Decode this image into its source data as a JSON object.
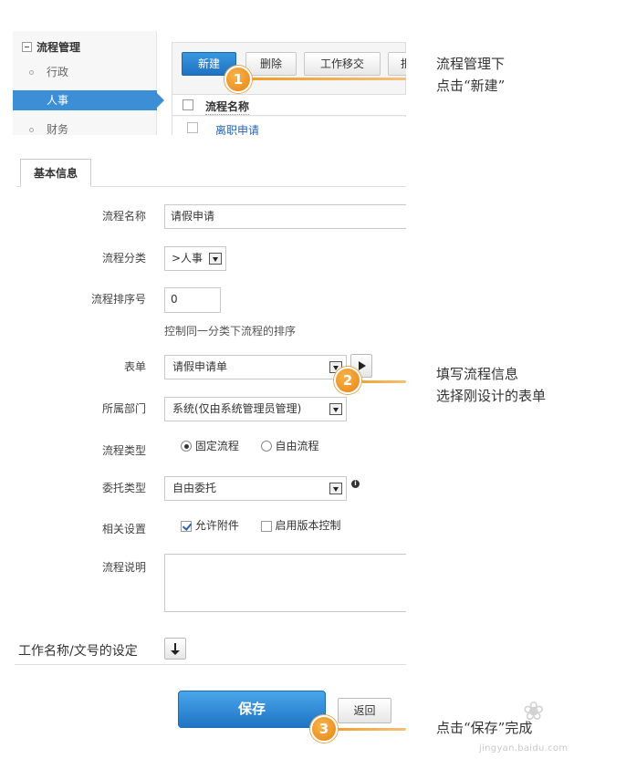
{
  "sidebar": {
    "title": "流程管理",
    "items": [
      {
        "label": "行政",
        "active": false
      },
      {
        "label": "人事",
        "active": true
      },
      {
        "label": "财务",
        "active": false
      }
    ]
  },
  "toolbar": {
    "new_label": "新建",
    "delete_label": "删除",
    "transfer_label": "工作移交",
    "batch_label": "批"
  },
  "list": {
    "column_header": "流程名称",
    "rows": [
      "离职申请"
    ]
  },
  "tabs": [
    {
      "label": "基本信息",
      "active": true
    }
  ],
  "form": {
    "name": {
      "label": "流程名称",
      "value": "请假申请"
    },
    "category": {
      "label": "流程分类",
      "value": ">人事"
    },
    "order": {
      "label": "流程排序号",
      "value": "0",
      "hint": "控制同一分类下流程的排序"
    },
    "form_select": {
      "label": "表单",
      "value": "请假申请单"
    },
    "department": {
      "label": "所属部门",
      "value": "系统(仅由系统管理员管理)"
    },
    "flow_type": {
      "label": "流程类型",
      "options": [
        "固定流程",
        "自由流程"
      ],
      "selected": "固定流程"
    },
    "delegate_type": {
      "label": "委托类型",
      "value": "自由委托"
    },
    "settings": {
      "label": "相关设置",
      "options": [
        {
          "label": "允许附件",
          "checked": true
        },
        {
          "label": "启用版本控制",
          "checked": false
        }
      ]
    },
    "description": {
      "label": "流程说明",
      "value": ""
    }
  },
  "section": {
    "title": "工作名称/文号的设定"
  },
  "actions": {
    "save_label": "保存",
    "back_label": "返回"
  },
  "annotations": {
    "step1": {
      "number": "1",
      "line1": "流程管理下",
      "line2": "点击“新建”"
    },
    "step2": {
      "number": "2",
      "line1": "填写流程信息",
      "line2": "选择刚设计的表单"
    },
    "step3": {
      "number": "3",
      "line1": "点击“保存”完成"
    }
  },
  "watermark": {
    "text": "jingyan.baidu.com"
  },
  "colors": {
    "primary_blue": "#1e74c4",
    "step_orange": "#e88414",
    "sidebar_active": "#3c8fd6"
  }
}
